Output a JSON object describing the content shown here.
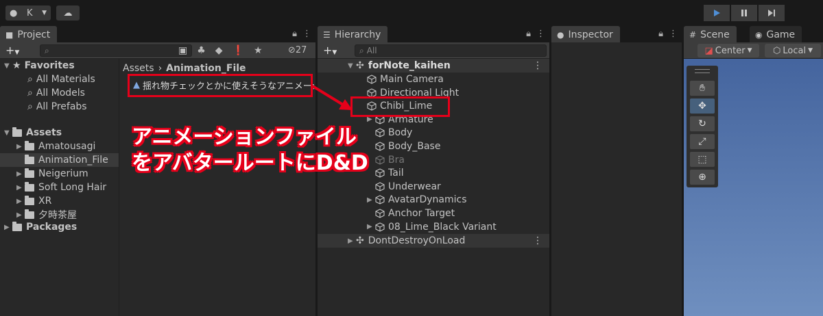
{
  "toolbar": {
    "account_label": "K",
    "cloud_icon": "cloud-icon",
    "play_icon": "play-icon",
    "pause_icon": "pause-icon",
    "step_icon": "step-icon"
  },
  "project": {
    "tab_label": "Project",
    "hidden_count": "27",
    "breadcrumb_root": "Assets",
    "breadcrumb_current": "Animation_File",
    "favorites": {
      "label": "Favorites",
      "items": [
        "All Materials",
        "All Models",
        "All Prefabs"
      ]
    },
    "assets": {
      "label": "Assets",
      "folders": [
        "Amatousagi",
        "Animation_File",
        "Neigerium",
        "Soft Long Hair",
        "XR",
        "夕時茶屋"
      ]
    },
    "packages_label": "Packages",
    "file_item": "揺れ物チェックとかに使えそうなアニメーショ"
  },
  "hierarchy": {
    "tab_label": "Hierarchy",
    "search_placeholder": "All",
    "scene_name": "forNote_kaihen",
    "items": [
      {
        "label": "Main Camera"
      },
      {
        "label": "Directional Light"
      },
      {
        "label": "Chibi_Lime"
      },
      {
        "label": "Armature"
      },
      {
        "label": "Body"
      },
      {
        "label": "Body_Base"
      },
      {
        "label": "Bra"
      },
      {
        "label": "Tail"
      },
      {
        "label": "Underwear"
      },
      {
        "label": "AvatarDynamics"
      },
      {
        "label": "Anchor Target"
      },
      {
        "label": "08_Lime_Black Variant"
      }
    ],
    "dontdestroy_label": "DontDestroyOnLoad"
  },
  "inspector": {
    "tab_label": "Inspector"
  },
  "scene": {
    "tab_label": "Scene",
    "game_tab_label": "Game",
    "pivot_label": "Center",
    "space_label": "Local"
  },
  "annotation": {
    "line1": "アニメーションファイル",
    "line2": "をアバタールートにD&D",
    "color": "#e6001a"
  }
}
